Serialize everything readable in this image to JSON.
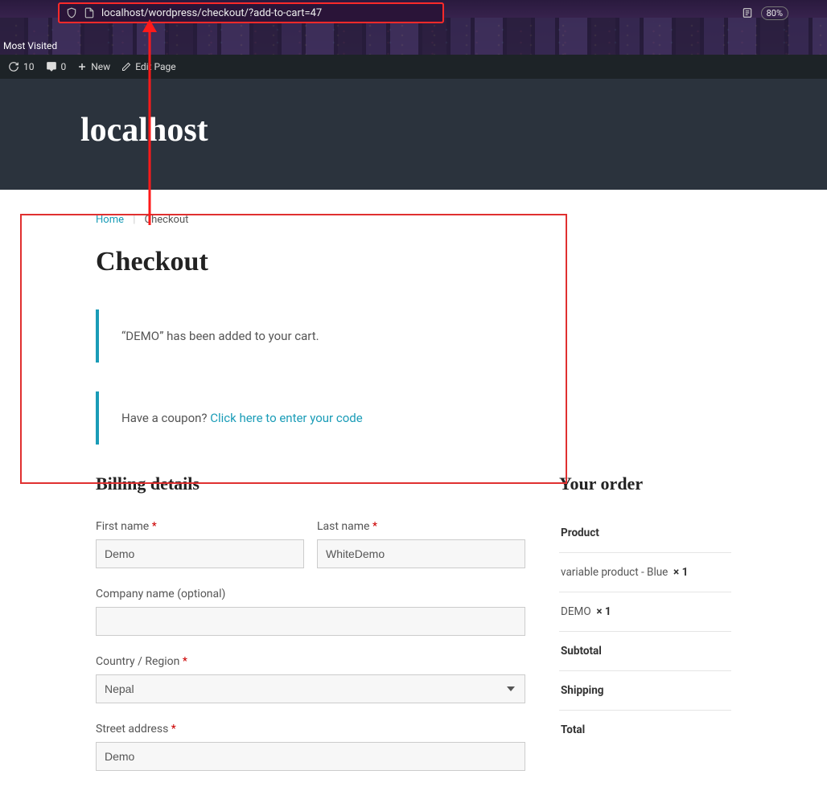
{
  "browser": {
    "url": "localhost/wordpress/checkout/?add-to-cart=47",
    "zoom": "80%",
    "bookmark_bar": "Most Visited"
  },
  "wp_bar": {
    "updates_count": "10",
    "comments_count": "0",
    "new_label": "New",
    "edit_label": "Edit Page"
  },
  "site": {
    "title": "localhost"
  },
  "breadcrumb": {
    "home": "Home",
    "current": "Checkout"
  },
  "page": {
    "title": "Checkout"
  },
  "notices": {
    "added": "“DEMO” has been added to your cart.",
    "coupon_prefix": "Have a coupon? ",
    "coupon_link": "Click here to enter your code"
  },
  "billing": {
    "heading": "Billing details",
    "first_name": {
      "label": "First name ",
      "value": "Demo"
    },
    "last_name": {
      "label": "Last name ",
      "value": "WhiteDemo"
    },
    "company": {
      "label": "Company name (optional)",
      "value": ""
    },
    "country": {
      "label": "Country / Region ",
      "value": "Nepal"
    },
    "street": {
      "label": "Street address ",
      "value": "Demo"
    }
  },
  "order": {
    "heading": "Your order",
    "header_product": "Product",
    "items": [
      {
        "name": "variable product - Blue",
        "qty": "× 1"
      },
      {
        "name": "DEMO",
        "qty": "× 1"
      }
    ],
    "subtotal_label": "Subtotal",
    "shipping_label": "Shipping",
    "total_label": "Total"
  }
}
